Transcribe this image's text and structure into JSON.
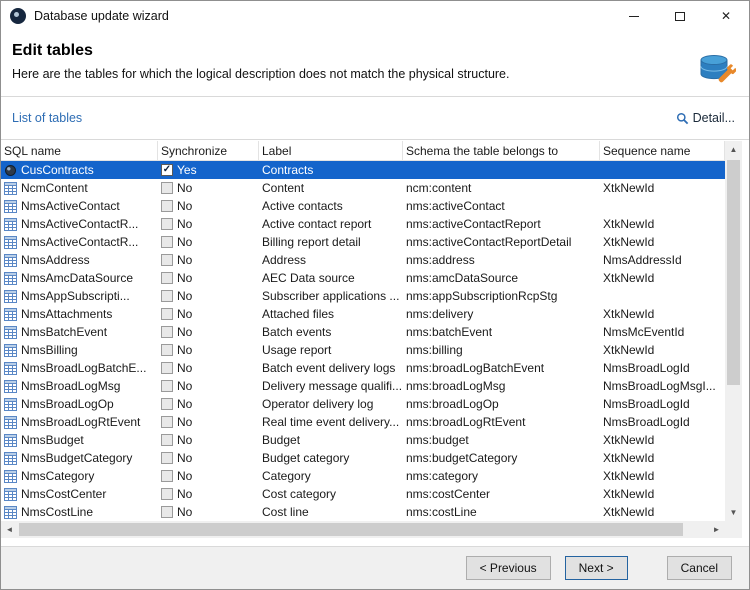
{
  "window": {
    "title": "Database update wizard"
  },
  "header": {
    "title": "Edit tables",
    "description": "Here are the tables for which the logical description does not match the physical structure."
  },
  "toolbar": {
    "list_label": "List of tables",
    "detail_label": "Detail..."
  },
  "table": {
    "columns": [
      "SQL name",
      "Synchronize",
      "Label",
      "Schema the table belongs to",
      "Sequence name"
    ],
    "rows": [
      {
        "icon": "record-icon",
        "sql": "CusContracts",
        "checked": true,
        "sync": "Yes",
        "label": "Contracts",
        "schema": "",
        "sequence": "",
        "selected": true
      },
      {
        "icon": "table-icon",
        "sql": "NcmContent",
        "checked": false,
        "sync": "No",
        "label": "Content",
        "schema": "ncm:content",
        "sequence": "XtkNewId"
      },
      {
        "icon": "table-icon",
        "sql": "NmsActiveContact",
        "checked": false,
        "sync": "No",
        "label": "Active contacts",
        "schema": "nms:activeContact",
        "sequence": ""
      },
      {
        "icon": "table-icon",
        "sql": "NmsActiveContactR...",
        "checked": false,
        "sync": "No",
        "label": "Active contact report",
        "schema": "nms:activeContactReport",
        "sequence": "XtkNewId"
      },
      {
        "icon": "table-icon",
        "sql": "NmsActiveContactR...",
        "checked": false,
        "sync": "No",
        "label": "Billing report detail",
        "schema": "nms:activeContactReportDetail",
        "sequence": "XtkNewId"
      },
      {
        "icon": "table-icon",
        "sql": "NmsAddress",
        "checked": false,
        "sync": "No",
        "label": "Address",
        "schema": "nms:address",
        "sequence": "NmsAddressId"
      },
      {
        "icon": "table-icon",
        "sql": "NmsAmcDataSource",
        "checked": false,
        "sync": "No",
        "label": "AEC Data source",
        "schema": "nms:amcDataSource",
        "sequence": "XtkNewId"
      },
      {
        "icon": "table-icon",
        "sql": "NmsAppSubscripti...",
        "checked": false,
        "sync": "No",
        "label": "Subscriber applications ...",
        "schema": "nms:appSubscriptionRcpStg",
        "sequence": ""
      },
      {
        "icon": "table-icon",
        "sql": "NmsAttachments",
        "checked": false,
        "sync": "No",
        "label": "Attached files",
        "schema": "nms:delivery",
        "sequence": "XtkNewId"
      },
      {
        "icon": "table-icon",
        "sql": "NmsBatchEvent",
        "checked": false,
        "sync": "No",
        "label": "Batch events",
        "schema": "nms:batchEvent",
        "sequence": "NmsMcEventId"
      },
      {
        "icon": "table-icon",
        "sql": "NmsBilling",
        "checked": false,
        "sync": "No",
        "label": "Usage report",
        "schema": "nms:billing",
        "sequence": "XtkNewId"
      },
      {
        "icon": "table-icon",
        "sql": "NmsBroadLogBatchE...",
        "checked": false,
        "sync": "No",
        "label": "Batch event delivery logs",
        "schema": "nms:broadLogBatchEvent",
        "sequence": "NmsBroadLogId"
      },
      {
        "icon": "table-icon",
        "sql": "NmsBroadLogMsg",
        "checked": false,
        "sync": "No",
        "label": "Delivery message qualifi...",
        "schema": "nms:broadLogMsg",
        "sequence": "NmsBroadLogMsgI..."
      },
      {
        "icon": "table-icon",
        "sql": "NmsBroadLogOp",
        "checked": false,
        "sync": "No",
        "label": "Operator delivery log",
        "schema": "nms:broadLogOp",
        "sequence": "NmsBroadLogId"
      },
      {
        "icon": "table-icon",
        "sql": "NmsBroadLogRtEvent",
        "checked": false,
        "sync": "No",
        "label": "Real time event delivery...",
        "schema": "nms:broadLogRtEvent",
        "sequence": "NmsBroadLogId"
      },
      {
        "icon": "table-icon",
        "sql": "NmsBudget",
        "checked": false,
        "sync": "No",
        "label": "Budget",
        "schema": "nms:budget",
        "sequence": "XtkNewId"
      },
      {
        "icon": "table-icon",
        "sql": "NmsBudgetCategory",
        "checked": false,
        "sync": "No",
        "label": "Budget category",
        "schema": "nms:budgetCategory",
        "sequence": "XtkNewId"
      },
      {
        "icon": "table-icon",
        "sql": "NmsCategory",
        "checked": false,
        "sync": "No",
        "label": "Category",
        "schema": "nms:category",
        "sequence": "XtkNewId"
      },
      {
        "icon": "table-icon",
        "sql": "NmsCostCenter",
        "checked": false,
        "sync": "No",
        "label": "Cost category",
        "schema": "nms:costCenter",
        "sequence": "XtkNewId"
      },
      {
        "icon": "table-icon",
        "sql": "NmsCostLine",
        "checked": false,
        "sync": "No",
        "label": "Cost line",
        "schema": "nms:costLine",
        "sequence": "XtkNewId"
      }
    ]
  },
  "footer": {
    "previous": "< Previous",
    "next": "Next >",
    "cancel": "Cancel"
  },
  "colors": {
    "selection": "#1464cb",
    "link": "#2e6db4"
  }
}
